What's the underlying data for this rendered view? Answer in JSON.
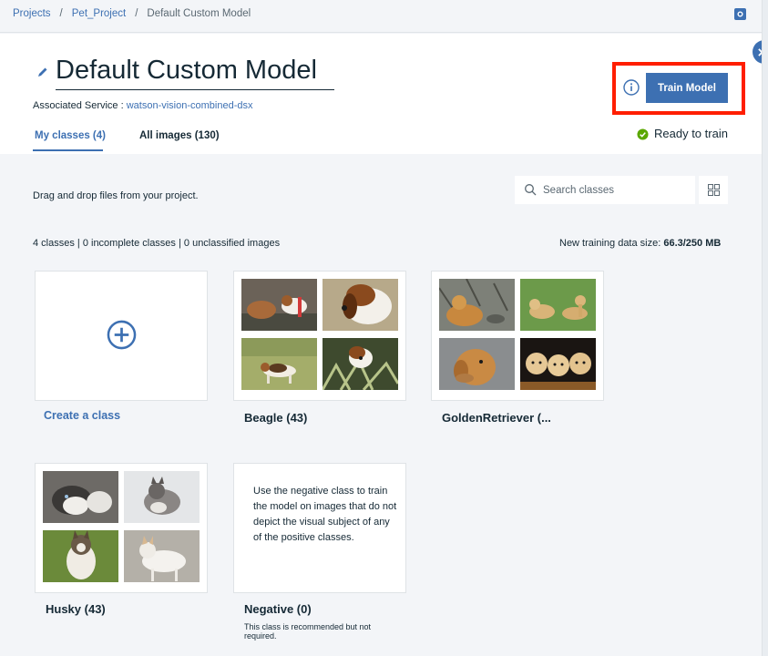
{
  "breadcrumb": {
    "items": [
      "Projects",
      "Pet_Project",
      "Default Custom Model"
    ],
    "separator": "/"
  },
  "header": {
    "title": "Default Custom Model",
    "associated_label": "Associated Service :",
    "associated_service": "watson-vision-combined-dsx",
    "train_button": "Train Model",
    "status": "Ready to train"
  },
  "tabs": [
    {
      "label": "My classes (4)",
      "active": true
    },
    {
      "label": "All images (130)",
      "active": false
    }
  ],
  "toolbar": {
    "drag_hint": "Drag and drop files from your project.",
    "search_placeholder": "Search classes"
  },
  "summary": {
    "counts": "4 classes | 0 incomplete classes | 0 unclassified images",
    "data_size_label": "New training data size:",
    "data_size_value": "66.3/250 MB"
  },
  "classes": {
    "create": "Create a class",
    "beagle": "Beagle (43)",
    "golden": "GoldenRetriever (...",
    "husky": "Husky (43)",
    "negative": "Negative (0)",
    "negative_desc": "Use the negative class to train the model on images that do not depict the visual subject of any of the positive classes.",
    "negative_note": "This class is recommended but not required."
  },
  "colors": {
    "accent": "#3d70b2",
    "highlight": "#ff1e00",
    "ready": "#5aa700"
  }
}
